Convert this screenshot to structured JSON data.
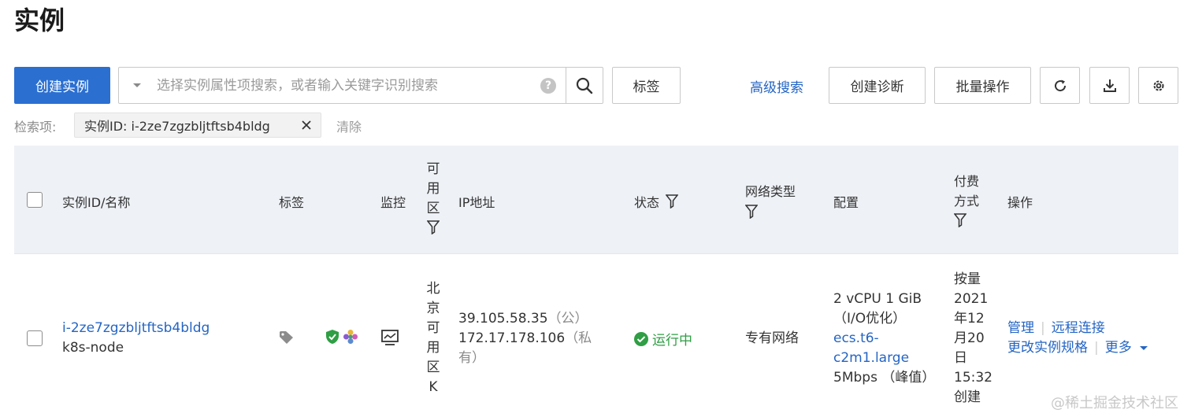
{
  "page": {
    "title": "实例"
  },
  "toolbar": {
    "create_label": "创建实例",
    "search_placeholder": "选择实例属性项搜索，或者输入关键字识别搜索",
    "tag_label": "标签",
    "advanced_search_label": "高级搜索",
    "diagnose_label": "创建诊断",
    "batch_label": "批量操作"
  },
  "filter": {
    "label": "检索项:",
    "chip_text": "实例ID: i-2ze7zgzbljtftsb4bldg",
    "clear_label": "清除"
  },
  "table": {
    "headers": {
      "id_name": "实例ID/名称",
      "tags": "标签",
      "monitor": "监控",
      "zone": [
        "可",
        "用",
        "区"
      ],
      "ip": "IP地址",
      "status": "状态",
      "network": "网络类型",
      "config": "配置",
      "billing": [
        "付费",
        "方式"
      ],
      "actions": "操作"
    },
    "rows": [
      {
        "instance_id": "i-2ze7zgzbljtftsb4bldg",
        "name": "k8s-node",
        "zone": [
          "北",
          "京",
          "可",
          "用",
          "区",
          "K"
        ],
        "ip_public": "39.105.58.35",
        "ip_public_tag": "（公）",
        "ip_private": "172.17.178.106",
        "ip_private_tag_1": "（私",
        "ip_private_tag_2": "有）",
        "status": "运行中",
        "network": "专有网络",
        "config_line1": "2 vCPU 1 GiB",
        "config_line2": "（I/O优化）",
        "config_type_1": "ecs.t6-",
        "config_type_2": "c2m1.large",
        "config_bw": "5Mbps （峰值）",
        "billing": [
          "按量",
          "2021",
          "年12",
          "月20",
          "日",
          "15:32",
          "创建"
        ],
        "actions": {
          "manage": "管理",
          "remote": "远程连接",
          "change_spec": "更改实例规格",
          "more": "更多"
        }
      }
    ]
  },
  "watermark": "@稀土掘金技术社区",
  "colors": {
    "primary": "#2b6fd1",
    "link": "#2465c4",
    "running": "#2f9e44",
    "header_bg": "#eef1f6"
  }
}
